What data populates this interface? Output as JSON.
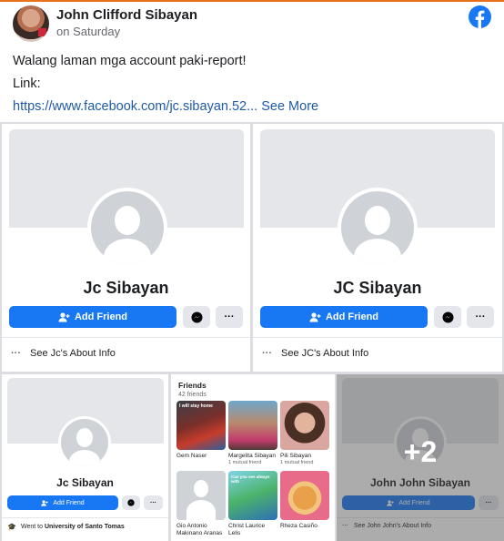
{
  "post": {
    "author": "John Clifford Sibayan",
    "time": "on Saturday",
    "message": "Walang laman mga account paki-report!",
    "link_label": "Link:",
    "link_text": "https://www.facebook.com/jc.sibayan.52...",
    "see_more": "See More"
  },
  "cards": [
    {
      "name": "Jc Sibayan",
      "add_friend": "Add Friend",
      "more": "···",
      "about": "See Jc's About Info"
    },
    {
      "name": "JC Sibayan",
      "add_friend": "Add Friend",
      "more": "···",
      "about": "See JC's About Info"
    },
    {
      "name": "Jc Sibayan",
      "add_friend": "Add Friend",
      "more": "···",
      "education_prefix": "Went to ",
      "education_school": "University of Santo Tomas"
    },
    {
      "name": "John John Sibayan",
      "add_friend": "Add Friend",
      "more": "···",
      "about": "See John John's About Info"
    }
  ],
  "friends_panel": {
    "title": "Friends",
    "count": "42 friends",
    "friends": [
      {
        "name": "Gem Naser",
        "mutual": "",
        "caption": "I will stay home"
      },
      {
        "name": "Margelita Sibayan",
        "mutual": "1 mutual friend",
        "caption": ""
      },
      {
        "name": "Pili Sibayan",
        "mutual": "1 mutual friend",
        "caption": ""
      },
      {
        "name": "Gio Antonio Makinano Aranas",
        "mutual": "",
        "caption": ""
      },
      {
        "name": "Christ Laurice Lelis",
        "mutual": "",
        "caption": "Can you see always with"
      },
      {
        "name": "Rheza Casiño",
        "mutual": "",
        "caption": ""
      }
    ]
  },
  "more_count": "+2",
  "colors": {
    "accent": "#1877f2",
    "link": "#1f5aa8",
    "top_border": "#e8711b"
  },
  "icons": [
    "facebook-icon",
    "add-friend-icon",
    "messenger-icon",
    "more-icon",
    "graduation-icon",
    "dots-icon"
  ]
}
